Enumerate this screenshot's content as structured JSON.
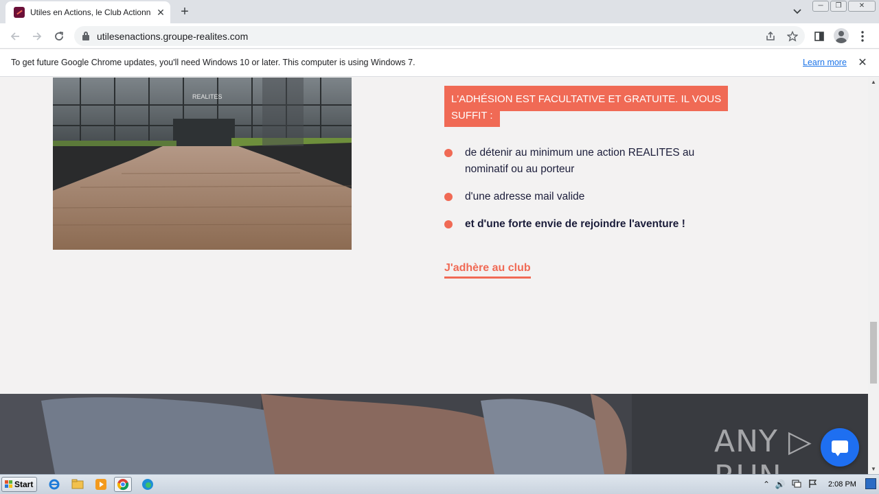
{
  "browser": {
    "tab_title": "Utiles en Actions, le Club Actionnaire",
    "tab_close": "✕",
    "new_tab": "+",
    "tab_search": "⌄",
    "window_min": "─",
    "window_restore": "❐",
    "window_close": "✕",
    "url": "utilesenactions.groupe-realites.com"
  },
  "infobar": {
    "message": "To get future Google Chrome updates, you'll need Windows 10 or later. This computer is using Windows 7.",
    "link": "Learn more",
    "close": "✕"
  },
  "page": {
    "photo_sign": "REALITES",
    "badge_line1": "L'ADHÉSION EST FACULTATIVE ET GRATUITE. IL VOUS",
    "badge_line2": "SUFFIT :",
    "bullets": [
      {
        "line1": "de détenir au minimum une action REALITES au",
        "line2": "nominatif ou au porteur"
      },
      {
        "line1": "d'une adresse mail valide"
      },
      {
        "line1": "et d'une forte envie de rejoindre l'aventure !"
      }
    ],
    "cta": "J'adhère au club",
    "watermark": "ANY ▷ RUN"
  },
  "colors": {
    "accent": "#f06a55",
    "text_dark": "#1b1d3a",
    "page_bg": "#f3f2f2",
    "chat": "#1e6ff1"
  },
  "taskbar": {
    "start": "Start",
    "clock": "2:08 PM"
  }
}
